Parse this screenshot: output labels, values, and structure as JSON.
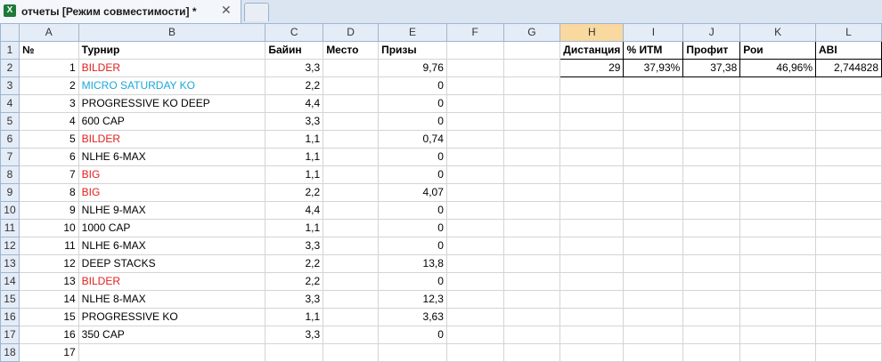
{
  "window": {
    "tab_title": "отчеты  [Режим совместимости] *",
    "close_glyph": "✕",
    "app_icon_letter": "X"
  },
  "columns": [
    "A",
    "B",
    "C",
    "D",
    "E",
    "F",
    "G",
    "H",
    "I",
    "J",
    "K",
    "L"
  ],
  "headers": {
    "no": "№",
    "tournament": "Турнир",
    "buyin": "Байин",
    "place": "Место",
    "prizes": "Призы"
  },
  "rows": [
    {
      "no": "1",
      "name": "BILDER",
      "buyin": "3,3",
      "prize": "9,76",
      "color": "red"
    },
    {
      "no": "2",
      "name": "MICRO SATURDAY KO",
      "buyin": "2,2",
      "prize": "0",
      "color": "cyan"
    },
    {
      "no": "3",
      "name": "PROGRESSIVE KO DEEP",
      "buyin": "4,4",
      "prize": "0",
      "color": "black"
    },
    {
      "no": "4",
      "name": "600 CAP",
      "buyin": "3,3",
      "prize": "0",
      "color": "black"
    },
    {
      "no": "5",
      "name": "BILDER",
      "buyin": "1,1",
      "prize": "0,74",
      "color": "red"
    },
    {
      "no": "6",
      "name": "NLHE 6-MAX",
      "buyin": "1,1",
      "prize": "0",
      "color": "black"
    },
    {
      "no": "7",
      "name": "BIG",
      "buyin": "1,1",
      "prize": "0",
      "color": "red"
    },
    {
      "no": "8",
      "name": "BIG",
      "buyin": "2,2",
      "prize": "4,07",
      "color": "red"
    },
    {
      "no": "9",
      "name": "NLHE 9-MAX",
      "buyin": "4,4",
      "prize": "0",
      "color": "black"
    },
    {
      "no": "10",
      "name": "1000 CAP",
      "buyin": "1,1",
      "prize": "0",
      "color": "black"
    },
    {
      "no": "11",
      "name": "NLHE 6-MAX",
      "buyin": "3,3",
      "prize": "0",
      "color": "black"
    },
    {
      "no": "12",
      "name": "DEEP STACKS",
      "buyin": "2,2",
      "prize": "13,8",
      "color": "black"
    },
    {
      "no": "13",
      "name": "BILDER",
      "buyin": "2,2",
      "prize": "0",
      "color": "red"
    },
    {
      "no": "14",
      "name": "NLHE 8-MAX",
      "buyin": "3,3",
      "prize": "12,3",
      "color": "black"
    },
    {
      "no": "15",
      "name": "PROGRESSIVE KO",
      "buyin": "1,1",
      "prize": "3,63",
      "color": "black"
    },
    {
      "no": "16",
      "name": "350 CAP",
      "buyin": "3,3",
      "prize": "0",
      "color": "black"
    },
    {
      "no": "17",
      "name": "",
      "buyin": "",
      "prize": "",
      "color": "black"
    }
  ],
  "stats": {
    "headers": [
      "Дистанция",
      "% ИТМ",
      "Профит",
      "Рои",
      "ABI"
    ],
    "values": [
      "29",
      "37,93%",
      "37,38",
      "46,96%",
      "2,744828"
    ]
  },
  "colors": {
    "selected_column": "#f9d99f",
    "header_bg": "#e4ecf7",
    "red_text": "#e0201c",
    "cyan_text": "#1aa8d8"
  }
}
